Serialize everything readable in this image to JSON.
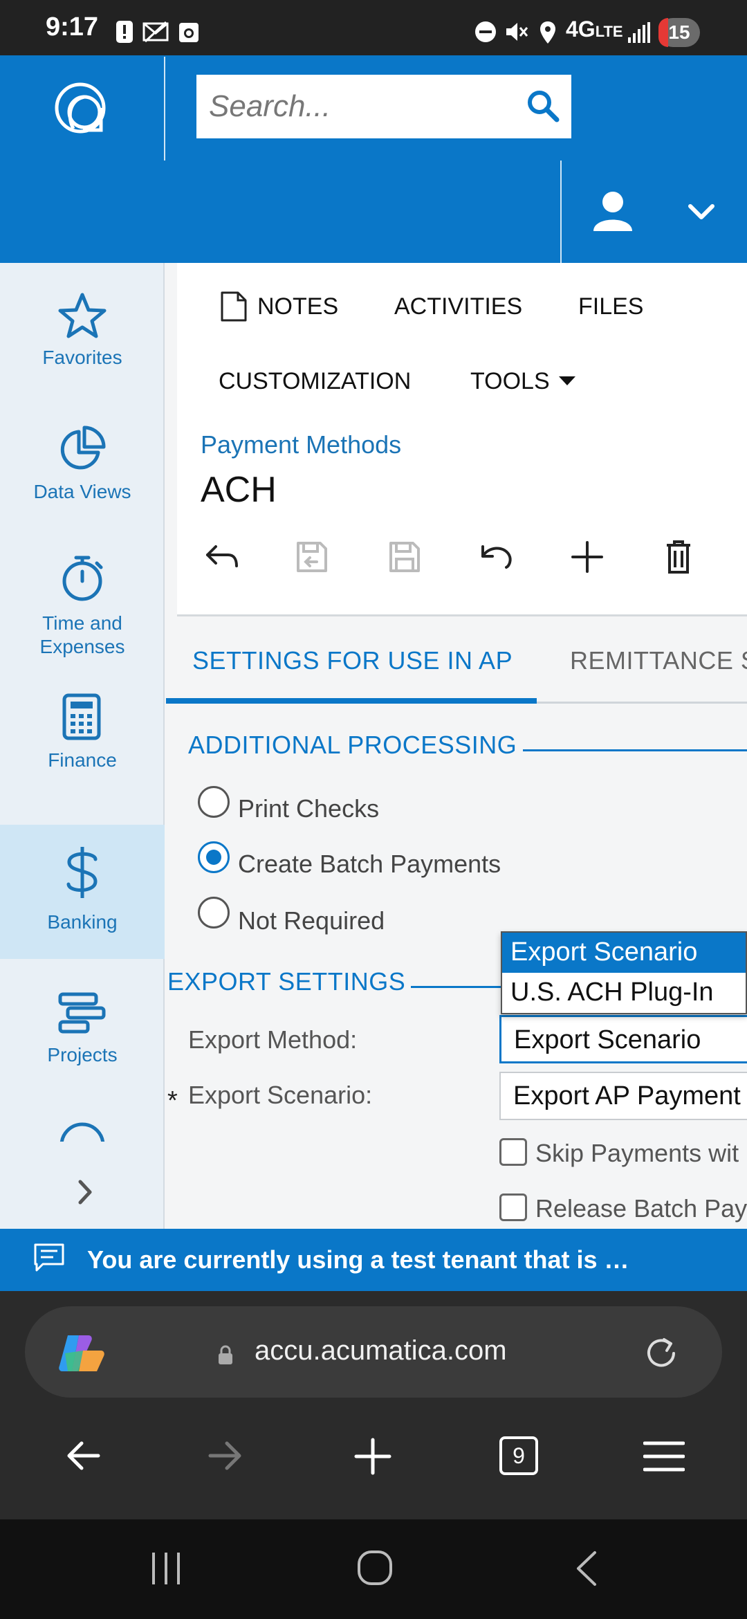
{
  "status_bar": {
    "time": "9:17",
    "network": "4G",
    "network_sub": "LTE",
    "notification_count": "15"
  },
  "header": {
    "search_placeholder": "Search..."
  },
  "sidebar": {
    "items": [
      {
        "label": "Favorites",
        "icon": "star-icon"
      },
      {
        "label": "Data Views",
        "icon": "pie-chart-icon"
      },
      {
        "label": "Time and",
        "label2": "Expenses",
        "icon": "stopwatch-icon"
      },
      {
        "label": "Finance",
        "icon": "calculator-icon"
      },
      {
        "label": "Banking",
        "icon": "dollar-icon"
      },
      {
        "label": "Projects",
        "icon": "projects-icon"
      }
    ]
  },
  "toolbar": {
    "notes": "NOTES",
    "activities": "ACTIVITIES",
    "files": "FILES",
    "customization": "CUSTOMIZATION",
    "tools": "TOOLS"
  },
  "page": {
    "breadcrumb": "Payment Methods",
    "title": "ACH"
  },
  "tabs": {
    "active": "SETTINGS FOR USE IN AP",
    "next": "REMITTANCE S"
  },
  "additional_processing": {
    "title": "ADDITIONAL PROCESSING",
    "options": [
      "Print Checks",
      "Create Batch Payments",
      "Not Required"
    ],
    "selected": "Create Batch Payments"
  },
  "export_settings": {
    "title": "EXPORT SETTINGS",
    "export_method_label": "Export Method:",
    "export_method_value": "Export Scenario",
    "required_mark": "*",
    "export_scenario_label": "Export Scenario:",
    "export_scenario_value": "Export AP Payment",
    "checkbox_1": "Skip Payments wit",
    "checkbox_2": "Release Batch Pay"
  },
  "dropdown": {
    "options": [
      "Export Scenario",
      "U.S. ACH Plug-In"
    ],
    "highlighted": "Export Scenario"
  },
  "banner": {
    "text": "You are currently using a test tenant that is …"
  },
  "browser": {
    "url": "accu.acumatica.com",
    "tab_count": "9"
  },
  "colors": {
    "accent": "#0a77c8",
    "header_bg": "#0a77c8",
    "sidebar_bg": "#e9f0f6",
    "active_item_bg": "#cfe6f5"
  }
}
